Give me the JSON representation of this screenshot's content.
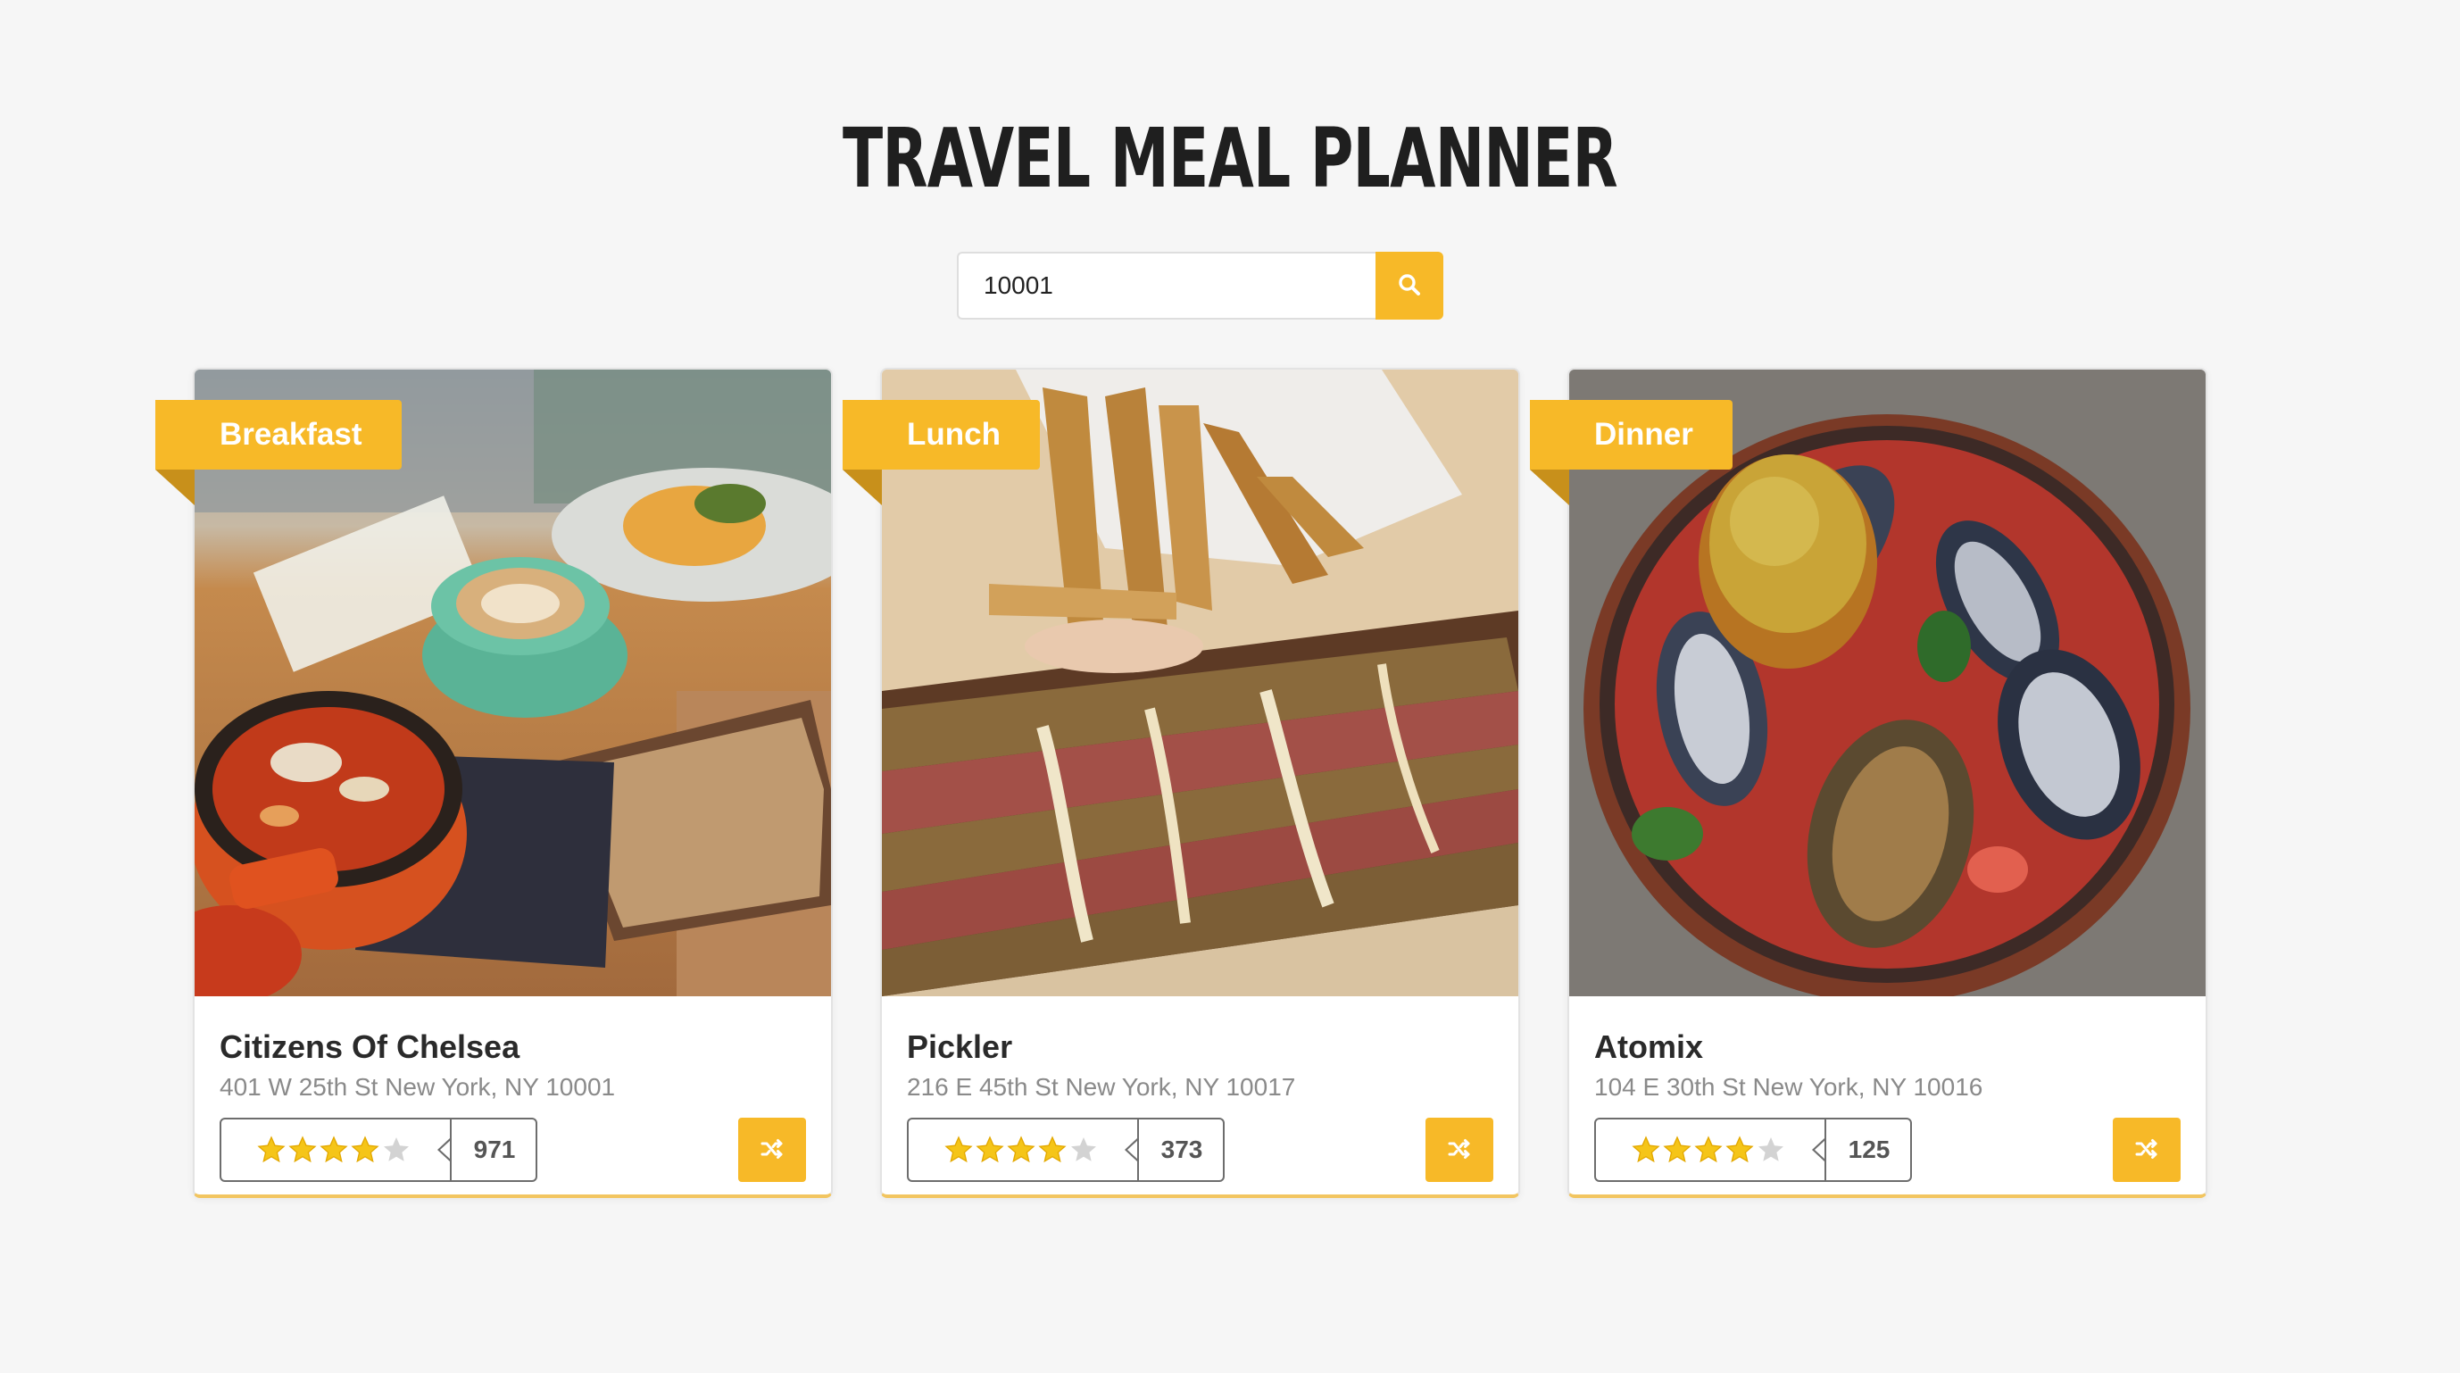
{
  "page": {
    "title": "TRAVEL MEAL PLANNER"
  },
  "search": {
    "value": "10001",
    "icon": "search-icon"
  },
  "colors": {
    "accent": "#f7b928",
    "ribbon_fold": "#c8901b",
    "background": "#f6f6f6",
    "text": "#2a2a2a",
    "muted_text": "#8a8a8a",
    "star_filled": "#f5c518",
    "star_empty": "#d3d3d3"
  },
  "meals": [
    {
      "meal": "Breakfast",
      "name": "Citizens Of Chelsea",
      "address": "401 W 25th St New York, NY 10001",
      "rating": 4,
      "rating_max": 5,
      "review_count": "971",
      "shuffle_icon": "shuffle-icon"
    },
    {
      "meal": "Lunch",
      "name": "Pickler",
      "address": "216 E 45th St New York, NY 10017",
      "rating": 4,
      "rating_max": 5,
      "review_count": "373",
      "shuffle_icon": "shuffle-icon"
    },
    {
      "meal": "Dinner",
      "name": "Atomix",
      "address": "104 E 30th St New York, NY 10016",
      "rating": 4,
      "rating_max": 5,
      "review_count": "125",
      "shuffle_icon": "shuffle-icon"
    }
  ]
}
